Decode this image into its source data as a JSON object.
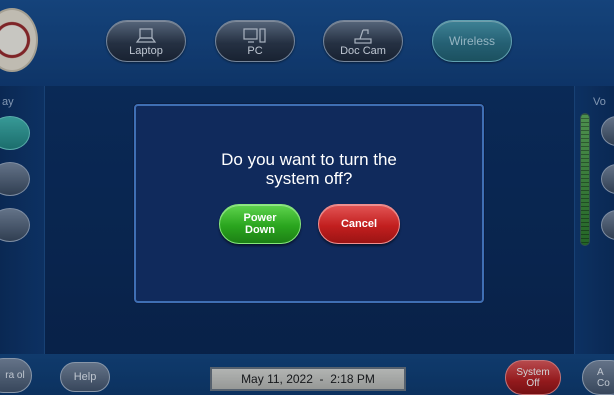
{
  "sources": [
    {
      "label": "Laptop",
      "icon": "laptop-icon"
    },
    {
      "label": "PC",
      "icon": "pc-icon"
    },
    {
      "label": "Doc Cam",
      "icon": "doc-cam-icon"
    },
    {
      "label": "Wireless",
      "icon": ""
    }
  ],
  "left_panel": {
    "label_fragment": "ay"
  },
  "right_panel": {
    "label_fragment": "Vo"
  },
  "volume": {
    "level": 1.0,
    "color": "#3f9a3b"
  },
  "dialog": {
    "message": "Do you want to turn the system off?",
    "confirm_label": "Power Down",
    "cancel_label": "Cancel"
  },
  "footer": {
    "left_label_fragment": "ra ol",
    "help_label": "Help",
    "datetime": "May 11, 2022  -  2:18 PM",
    "system_off_label": "System Off",
    "right_label_fragment": "A Co"
  },
  "colors": {
    "confirm": "#2aa51e",
    "cancel": "#c21f1f",
    "dialog_bg": "#102a5c",
    "accent_teal": "#2e9c96"
  }
}
